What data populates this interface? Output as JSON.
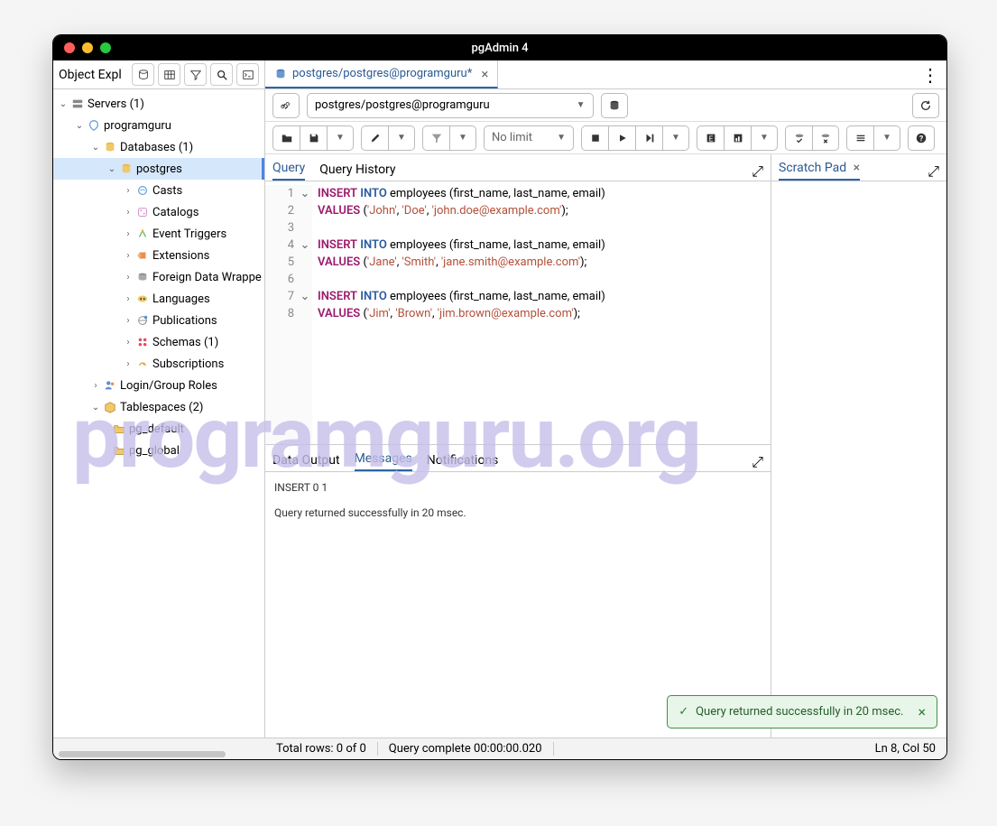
{
  "window": {
    "title": "pgAdmin 4"
  },
  "sidebar": {
    "title": "Object Expl",
    "tree": {
      "servers": "Servers (1)",
      "server": "programguru",
      "databases": "Databases (1)",
      "db": "postgres",
      "children": [
        "Casts",
        "Catalogs",
        "Event Triggers",
        "Extensions",
        "Foreign Data Wrappe",
        "Languages",
        "Publications",
        "Schemas (1)",
        "Subscriptions"
      ],
      "loginroles": "Login/Group Roles",
      "tablespaces": "Tablespaces (2)",
      "ts_children": [
        "pg_default",
        "pg_global"
      ]
    }
  },
  "tab": {
    "label": "postgres/postgres@programguru*"
  },
  "conn": {
    "text": "postgres/postgres@programguru"
  },
  "toolbar": {
    "limit": "No limit"
  },
  "editor_tabs": {
    "query": "Query",
    "history": "Query History"
  },
  "scratch": {
    "label": "Scratch Pad"
  },
  "code": {
    "line1": {
      "kw": "INSERT",
      "kw2": "INTO",
      "rest": " employees (first_name, last_name, email)"
    },
    "line2": {
      "kw": "VALUES",
      "open": " (",
      "s1": "'John'",
      "c1": ", ",
      "s2": "'Doe'",
      "c2": ", ",
      "s3": "'john.doe@example.com'",
      "end": ");"
    },
    "line4": {
      "kw": "INSERT",
      "kw2": "INTO",
      "rest": " employees (first_name, last_name, email)"
    },
    "line5": {
      "kw": "VALUES",
      "open": " (",
      "s1": "'Jane'",
      "c1": ", ",
      "s2": "'Smith'",
      "c2": ", ",
      "s3": "'jane.smith@example.com'",
      "end": ");"
    },
    "line7": {
      "kw": "INSERT",
      "kw2": "INTO",
      "rest": " employees (first_name, last_name, email)"
    },
    "line8": {
      "kw": "VALUES",
      "open": " (",
      "s1": "'Jim'",
      "c1": ", ",
      "s2": "'Brown'",
      "c2": ", ",
      "s3": "'jim.brown@example.com'",
      "end": ");"
    }
  },
  "output_tabs": {
    "data": "Data Output",
    "msg": "Messages",
    "notif": "Notifications"
  },
  "messages": {
    "l1": "INSERT 0 1",
    "l2": "Query returned successfully in 20 msec."
  },
  "toast": {
    "text": "Query returned successfully in 20 msec."
  },
  "status": {
    "rows": "Total rows: 0 of 0",
    "complete": "Query complete 00:00:00.020",
    "pos": "Ln 8, Col 50"
  },
  "watermark": "programguru.org"
}
